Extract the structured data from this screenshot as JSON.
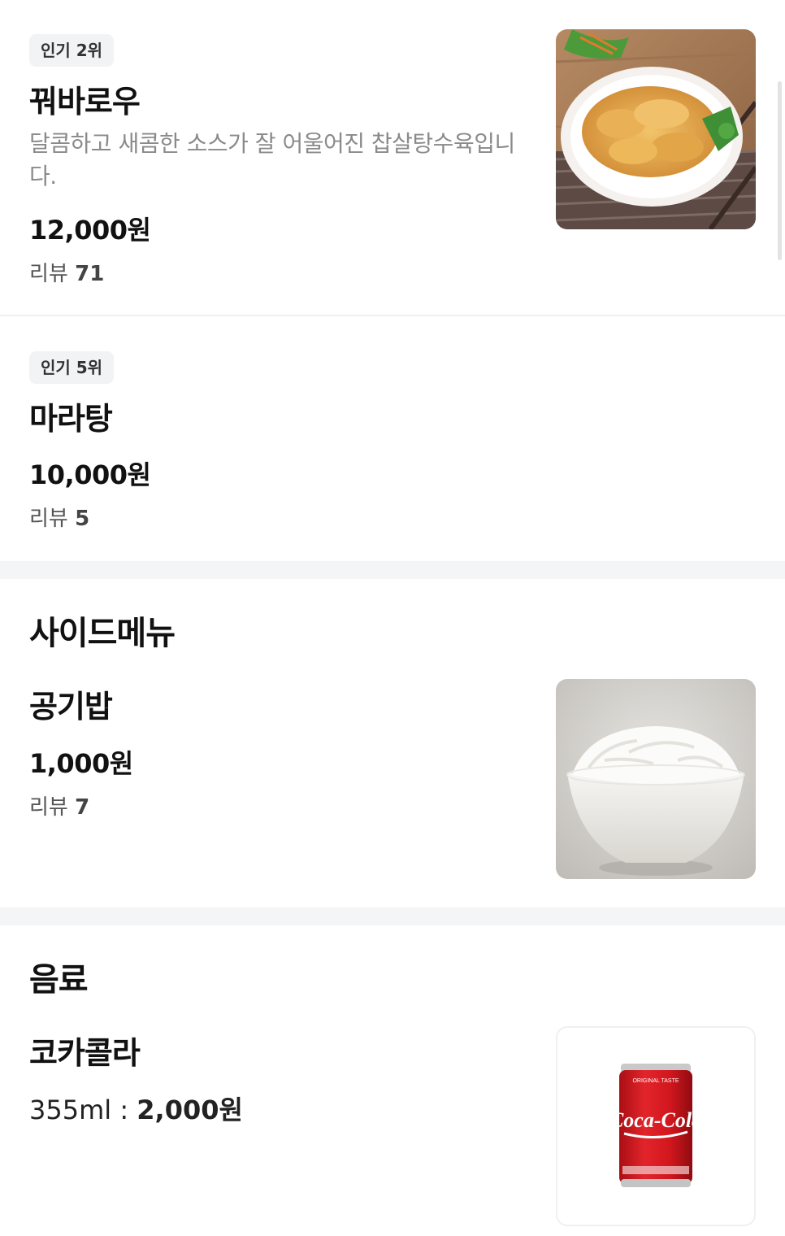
{
  "menu": {
    "items": [
      {
        "badge": "인기 2위",
        "name": "꿔바로우",
        "description": "달콤하고 새콤한 소스가  잘 어울어진 찹살탕수육입니다.",
        "price": "12,000원",
        "review_label": "리뷰",
        "review_count": "71",
        "image_icon": "sweet-sour-pork-photo"
      },
      {
        "badge": "인기 5위",
        "name": "마라탕",
        "price": "10,000원",
        "review_label": "리뷰",
        "review_count": "5"
      }
    ],
    "sections": [
      {
        "title": "사이드메뉴",
        "items": [
          {
            "name": "공기밥",
            "price": "1,000원",
            "review_label": "리뷰",
            "review_count": "7",
            "image_icon": "rice-bowl-photo"
          }
        ]
      },
      {
        "title": "음료",
        "items": [
          {
            "name": "코카콜라",
            "volume": "355ml : ",
            "price": "2,000원",
            "image_icon": "cola-can-photo",
            "can_text": "Coca-Cola",
            "can_top_text": "ORIGINAL TASTE"
          }
        ]
      }
    ]
  },
  "colors": {
    "badge_bg": "#f1f3f5",
    "section_band": "#f4f5f7",
    "coke_red": "#d9151c"
  }
}
